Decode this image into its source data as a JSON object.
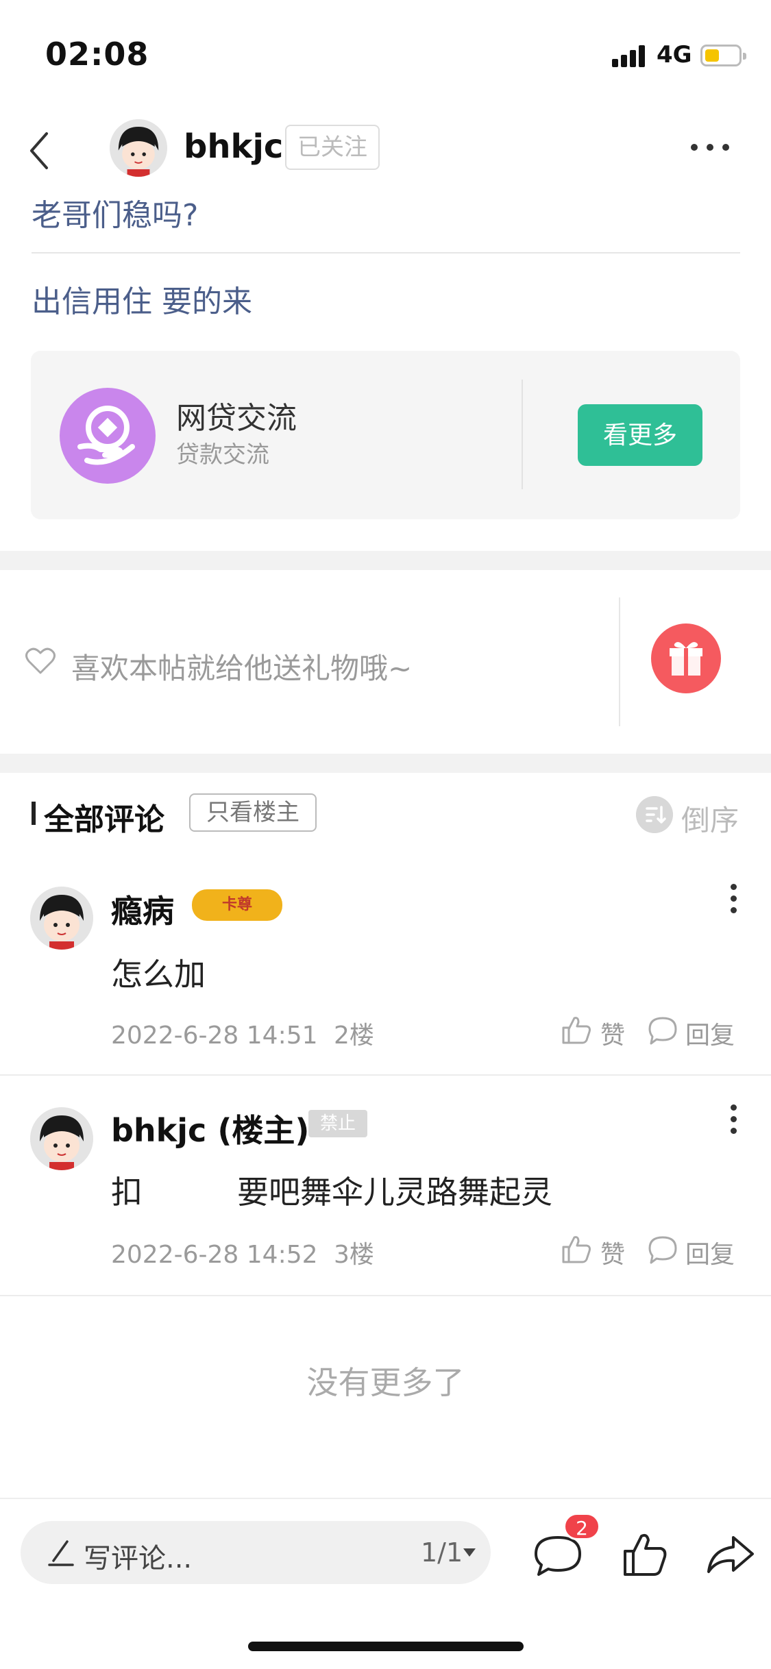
{
  "status_bar": {
    "time": "02:08",
    "network": "4G"
  },
  "header": {
    "username": "bhkjc",
    "follow_label": "已关注"
  },
  "post": {
    "title": "老哥们稳吗?",
    "body": "出信用住 要的来"
  },
  "forum_card": {
    "name": "网贷交流",
    "subtitle": "贷款交流",
    "button_label": "看更多"
  },
  "gift": {
    "prompt": "喜欢本帖就给他送礼物哦~"
  },
  "comments_header": {
    "title": "全部评论",
    "op_only_label": "只看楼主",
    "sort_label": "倒序"
  },
  "comments": [
    {
      "author": "瘾病",
      "badge": "卡尊",
      "text": "怎么加",
      "time": "2022-6-28 14:51",
      "floor": "2楼",
      "like_label": "赞",
      "reply_label": "回复"
    },
    {
      "author": "bhkjc (楼主)",
      "badge": "禁止",
      "text": "扣　　　要吧舞伞儿灵路舞起灵",
      "time": "2022-6-28 14:52",
      "floor": "3楼",
      "like_label": "赞",
      "reply_label": "回复"
    }
  ],
  "footer_text": "没有更多了",
  "bottom_bar": {
    "input_placeholder": "写评论...",
    "page_indicator": "1/1",
    "comment_count": "2"
  },
  "icons": {
    "back": "chevron-left-icon",
    "more": "more-horizontal-icon",
    "heart": "heart-outline-icon",
    "gift": "gift-icon",
    "sort": "sort-icon",
    "like": "thumbs-up-icon",
    "reply": "speech-bubble-icon",
    "share": "share-arrow-icon",
    "pen": "pen-icon"
  },
  "colors": {
    "link_blue": "#4b5e8a",
    "accent_green": "#2fbf96",
    "gift_red": "#f55a5f",
    "badge_red": "#f0424a",
    "forum_purple": "#c986ec"
  }
}
